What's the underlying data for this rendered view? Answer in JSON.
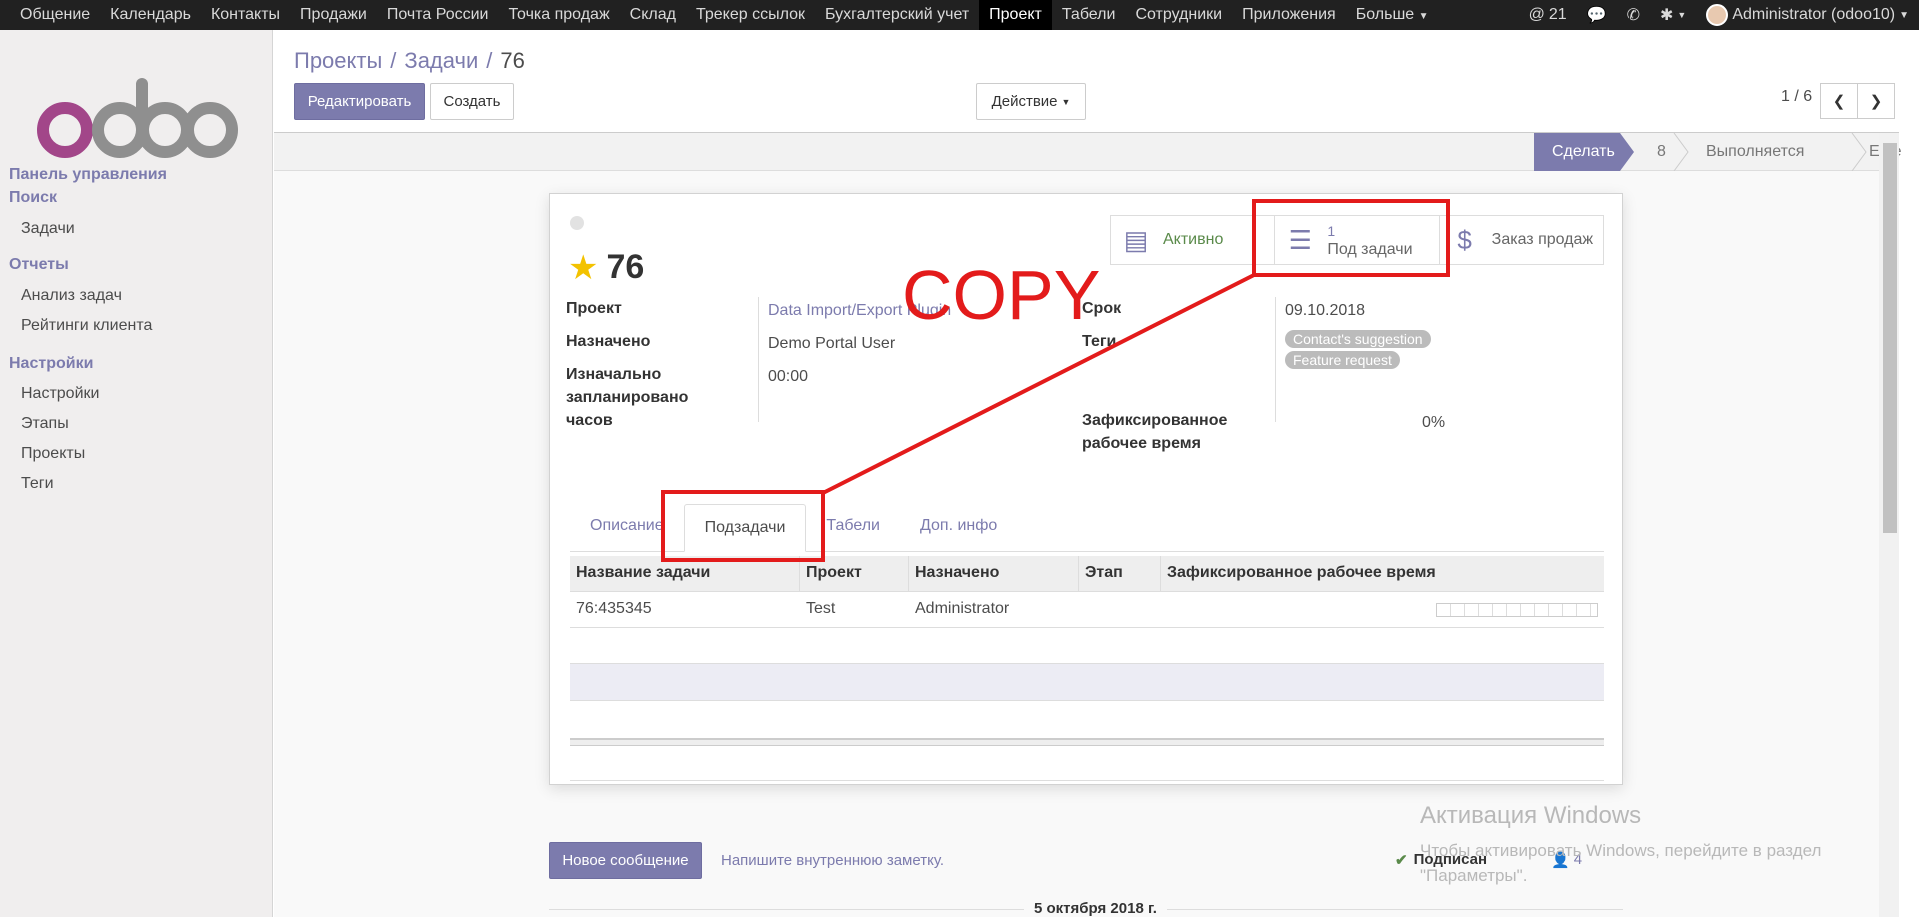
{
  "topbar": {
    "menu": [
      "Общение",
      "Календарь",
      "Контакты",
      "Продажи",
      "Почта России",
      "Точка продаж",
      "Склад",
      "Трекер ссылок",
      "Бухгалтерский учет",
      "Проект",
      "Табели",
      "Сотрудники",
      "Приложения",
      "Больше"
    ],
    "active_index": 9,
    "more_label": "Больше",
    "mentions": "21",
    "user": "Administrator (odoo10)"
  },
  "sidebar": {
    "logo": "odoo",
    "sections": [
      {
        "title": "Панель управления",
        "items": []
      },
      {
        "title": "Поиск",
        "items": [
          "Задачи"
        ]
      },
      {
        "title": "Отчеты",
        "items": [
          "Анализ задач",
          "Рейтинги клиента"
        ]
      },
      {
        "title": "Настройки",
        "items": [
          "Настройки",
          "Этапы",
          "Проекты",
          "Теги"
        ]
      }
    ]
  },
  "control_panel": {
    "breadcrumb": [
      "Проекты",
      "Задачи",
      "76"
    ],
    "edit_label": "Редактировать",
    "create_label": "Создать",
    "action_label": "Действие",
    "pager": "1 / 6"
  },
  "statusbar": {
    "stages": [
      "Сделать",
      "8",
      "Выполняется",
      "Еще"
    ],
    "active": "Сделать"
  },
  "form": {
    "title": "76",
    "smart_buttons": {
      "active_label": "Активно",
      "subtasks_count": "1",
      "subtasks_label": "Под задачи",
      "sale_label": "Заказ продаж"
    },
    "left_fields": [
      {
        "label": "Проект",
        "value": "Data Import/Export Plugin"
      },
      {
        "label": "Назначено",
        "value": "Demo Portal User"
      },
      {
        "label": "Изначально запланировано часов",
        "value": "00:00"
      }
    ],
    "right_fields": {
      "deadline_label": "Срок",
      "deadline_value": "09.10.2018",
      "tags_label": "Теги",
      "tags": [
        "Contact's suggestion",
        "Feature request"
      ],
      "progress_label": "Зафиксированное рабочее время",
      "progress_value": "0%"
    },
    "tabs": [
      "Описание",
      "Подзадачи",
      "Табели",
      "Доп. инфо"
    ],
    "active_tab": "Подзадачи",
    "grid": {
      "headers": [
        "Название задачи",
        "Проект",
        "Назначено",
        "Этап",
        "Зафиксированное рабочее время"
      ],
      "rows": [
        {
          "name": "76:435345",
          "project": "Test",
          "assigned": "Administrator",
          "stage": "",
          "progress": 0
        }
      ]
    }
  },
  "chatter": {
    "new_message_label": "Новое сообщение",
    "note_label": "Напишите внутреннюю заметку.",
    "follow_label": "Подписан",
    "followers": "4",
    "date": "5 октября 2018 г."
  },
  "windows_watermark": {
    "title": "Активация Windows",
    "text": "Чтобы активировать Windows, перейдите в раздел \"Параметры\"."
  },
  "annotation": {
    "copy_text": "COPY",
    "color": "#e31b1b"
  },
  "colors": {
    "brand": "#7c7bad",
    "topbar": "#212121",
    "star": "#f3c200"
  }
}
